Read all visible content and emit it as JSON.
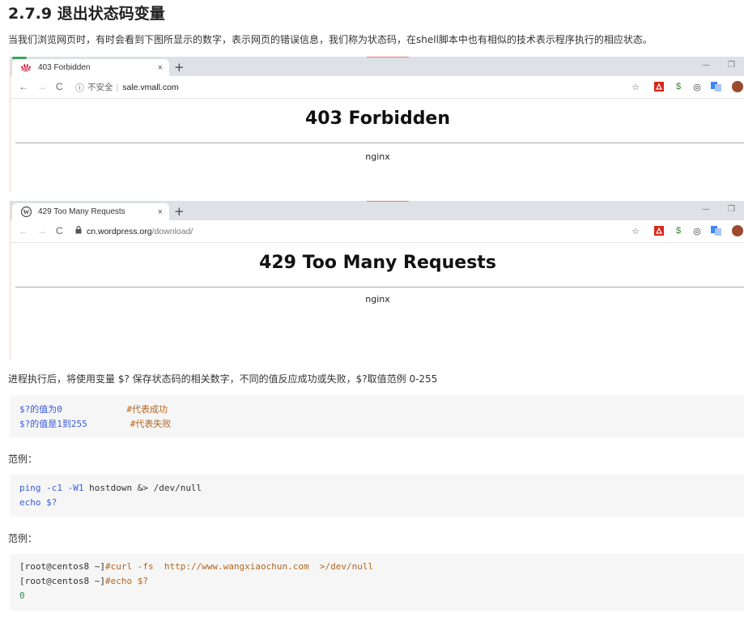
{
  "section": {
    "title": "2.7.9 退出状态码变量",
    "intro": "当我们浏览网页时，有时会看到下图所显示的数字，表示网页的错误信息，我们称为状态码，在shell脚本中也有相似的技术表示程序执行的相应状态。"
  },
  "browser1": {
    "tab_title": "403 Forbidden",
    "tab_close": "×",
    "new_tab": "+",
    "security_label": "不安全",
    "url_host": "sale.vmall.com",
    "url_path": "",
    "heading": "403 Forbidden",
    "server": "nginx"
  },
  "browser2": {
    "tab_title": "429 Too Many Requests",
    "tab_close": "×",
    "new_tab": "+",
    "url_host": "cn.wordpress.org",
    "url_path": "/download/",
    "heading": "429 Too Many Requests",
    "server": "nginx"
  },
  "para_after": "进程执行后，将使用变量 $? 保存状态码的相关数字，不同的值反应成功或失败，$?取值范例 0-255",
  "code1": {
    "line1_text": "$?的值为0",
    "line1_comment": "#代表成功",
    "line2_text": "$?的值是1到255",
    "line2_comment": "#代表失败"
  },
  "example_label_1": "范例：",
  "code2": {
    "line1_cmd": "ping",
    "line1_opts": "-c1 -W1",
    "line1_rest": " hostdown &> /dev/null",
    "line2_cmd": "echo",
    "line2_var": "$?"
  },
  "example_label_2": "范例：",
  "code3": {
    "line1_prompt": "[root@centos8 ~]",
    "line1_cmd": "#curl -fs",
    "line1_url": "http://www.wangxiaochun.com",
    "line1_rest": " >/dev/null",
    "line2_prompt": "[root@centos8 ~]",
    "line2_cmd": "#echo $?",
    "line3_output": "0"
  },
  "colors": {
    "keyword": "#3b5bdb",
    "comment": "#b5651d",
    "number": "#2e8b57",
    "code_bg": "#f6f6f6",
    "tabbar_bg": "#dee1e6"
  }
}
